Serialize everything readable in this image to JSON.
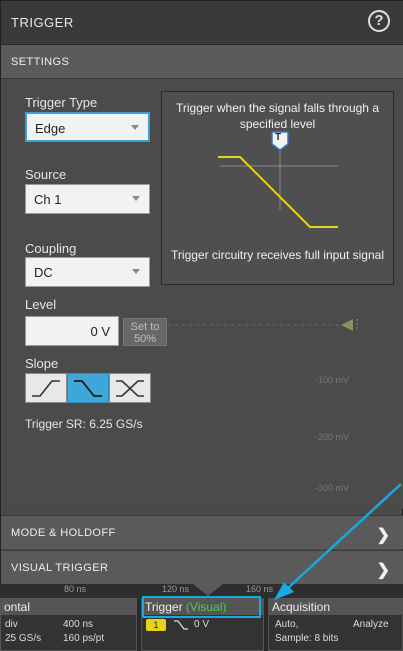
{
  "panel": {
    "title": "TRIGGER",
    "help_icon": "?"
  },
  "settings": {
    "header": "SETTINGS"
  },
  "trigger_type": {
    "label": "Trigger Type",
    "value": "Edge"
  },
  "source": {
    "label": "Source",
    "value": "Ch 1"
  },
  "coupling": {
    "label": "Coupling",
    "value": "DC"
  },
  "info": {
    "top_text": "Trigger when the signal falls through a specified level",
    "marker": "T",
    "bottom_text": "Trigger circuitry receives full input signal"
  },
  "level": {
    "label": "Level",
    "value": "0 V",
    "set_to_50": "Set to 50%"
  },
  "slope": {
    "label": "Slope",
    "options": [
      "rising",
      "falling",
      "either"
    ],
    "selected": "falling"
  },
  "sample_rate": "Trigger SR: 6.25 GS/s",
  "sections": {
    "mode_holdoff": "MODE & HOLDOFF",
    "visual_trigger": "VISUAL TRIGGER"
  },
  "axis": {
    "ticks": [
      "80 ns",
      "120 ns",
      "160 ns"
    ],
    "y_ticks": [
      "-100 mV",
      "-200 mV",
      "-300 mV"
    ]
  },
  "bottom": {
    "horizontal": {
      "header": "ontal",
      "row1_a": "div",
      "row1_b": "400 ns",
      "row2_a": "25 GS/s",
      "row2_b": "160 ps/pt"
    },
    "trigger": {
      "header_prefix": "Trigger ",
      "header_mode": "(Visual)",
      "channel": "1",
      "level": "0 V"
    },
    "acquisition": {
      "header": "Acquisition",
      "row1_a": "Auto,",
      "row1_b": "Analyze",
      "row2": "Sample: 8 bits"
    }
  },
  "colors": {
    "accent": "#3fa6d8",
    "visual_green": "#4ccc4c",
    "yellow": "#e6d21e",
    "callout": "#19a8e0"
  }
}
